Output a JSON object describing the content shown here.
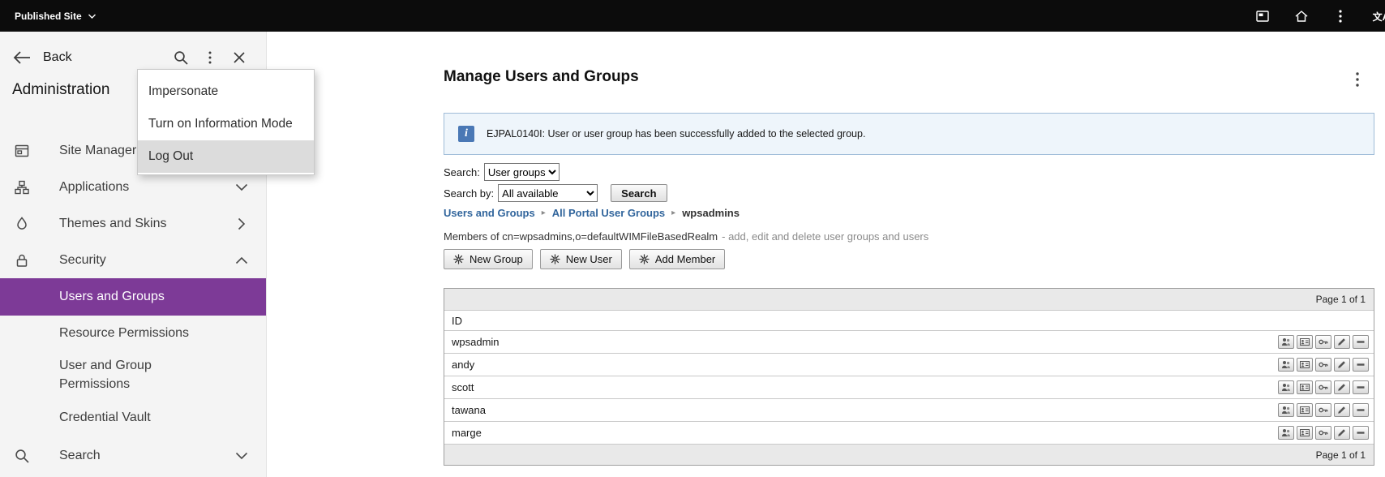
{
  "topbar": {
    "published_site": "Published Site",
    "translate_glyph": "文A"
  },
  "sidebar": {
    "back": "Back",
    "title": "Administration",
    "items": [
      {
        "label": "Site Manager",
        "icon": "site-manager-icon",
        "chevron": "none"
      },
      {
        "label": "Applications",
        "icon": "applications-icon",
        "chevron": "down"
      },
      {
        "label": "Themes and Skins",
        "icon": "themes-icon",
        "chevron": "right"
      },
      {
        "label": "Security",
        "icon": "security-icon",
        "chevron": "up"
      }
    ],
    "security_subitems": [
      "Users and Groups",
      "Resource Permissions",
      "User and Group Permissions",
      "Credential Vault"
    ],
    "selected_subitem": "Users and Groups",
    "search_item": "Search"
  },
  "context_menu": {
    "items": [
      "Impersonate",
      "Turn on Information Mode",
      "Log Out"
    ],
    "highlighted": "Log Out"
  },
  "main": {
    "title": "Manage Users and Groups",
    "info_icon_glyph": "i",
    "info_message": "EJPAL0140I: User or user group has been successfully added to the selected group.",
    "search_label": "Search:",
    "search_value": "User groups",
    "search_by_label": "Search by:",
    "search_by_value": "All available",
    "search_button": "Search",
    "breadcrumb": [
      "Users and Groups",
      "All Portal User Groups",
      "wpsadmins"
    ],
    "breadcrumb_separator": "▸",
    "members_text": "Members of cn=wpsadmins,o=defaultWIMFileBasedRealm",
    "members_hint": "- add, edit and delete user groups and users",
    "buttons": [
      "New Group",
      "New User",
      "Add Member"
    ],
    "table": {
      "pagination_top": "Page 1 of 1",
      "pagination_bottom": "Page 1 of 1",
      "column_header": "ID",
      "rows": [
        "wpsadmin",
        "andy",
        "scott",
        "tawana",
        "marge"
      ],
      "row_action_icons": [
        "membership-icon",
        "profile-icon",
        "roles-icon",
        "edit-icon",
        "remove-icon"
      ]
    }
  },
  "colors": {
    "accent_purple": "#7d3a97",
    "info_blue": "#4a78b5",
    "link_blue": "#31659c",
    "topbar_black": "#0c0c0c",
    "sidebar_gray": "#f4f4f4"
  }
}
